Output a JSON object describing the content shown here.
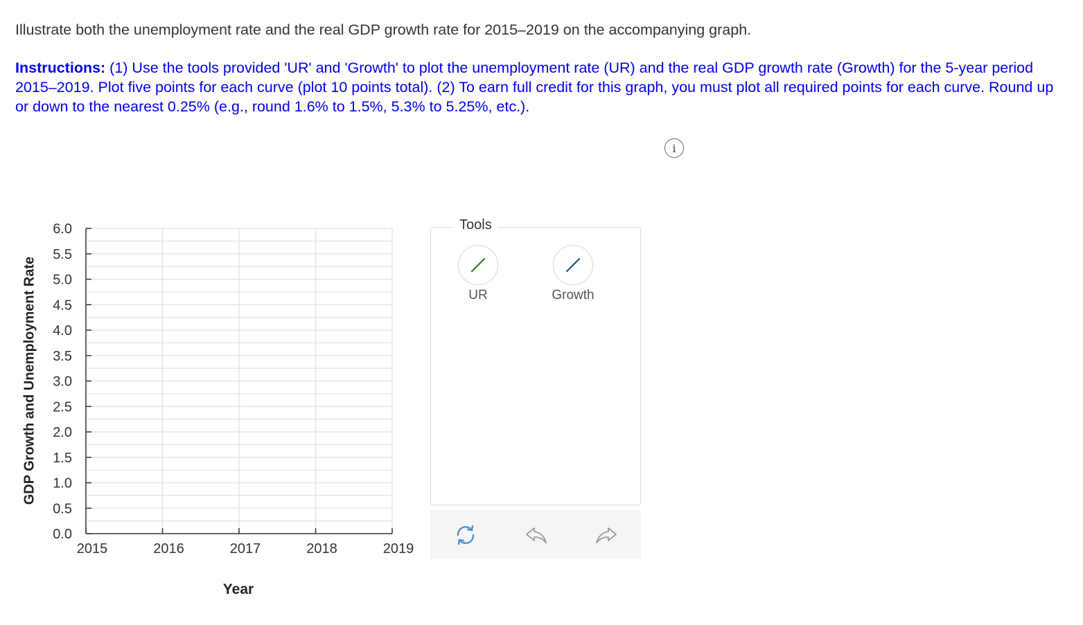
{
  "question": {
    "text": "Illustrate both the unemployment rate and the real GDP growth rate for 2015–2019 on the accompanying graph."
  },
  "instructions": {
    "label": "Instructions:",
    "text": " (1) Use the tools provided 'UR' and 'Growth' to plot the unemployment rate (UR) and the real GDP growth rate (Growth) for the 5-year period 2015–2019. Plot five points for each curve (plot 10 points total). (2) To earn full credit for this graph, you must plot all required points for each curve. Round up or down to the nearest 0.25% (e.g., round 1.6% to 1.5%, 5.3% to 5.25%, etc.)."
  },
  "info_icon": {
    "glyph": "i"
  },
  "chart_data": {
    "type": "line",
    "xlabel": "Year",
    "ylabel": "GDP Growth and Unemployment Rate",
    "categories": [
      "2015",
      "2016",
      "2017",
      "2018",
      "2019"
    ],
    "yticks": [
      "0.0",
      "0.5",
      "1.0",
      "1.5",
      "2.0",
      "2.5",
      "3.0",
      "3.5",
      "4.0",
      "4.5",
      "5.0",
      "5.5",
      "6.0"
    ],
    "ylim": [
      0,
      6
    ],
    "minor_step": 0.25,
    "grid": true,
    "series": []
  },
  "tools": {
    "title": "Tools",
    "items": [
      {
        "label": "UR",
        "icon": "line-tool-icon",
        "color": "#2e7d1f"
      },
      {
        "label": "Growth",
        "icon": "line-tool-icon",
        "color": "#1f4e8c"
      }
    ]
  },
  "actions": {
    "reset_color": "#4a90d9",
    "undo_color": "#9a9a9a",
    "redo_color": "#9a9a9a"
  }
}
